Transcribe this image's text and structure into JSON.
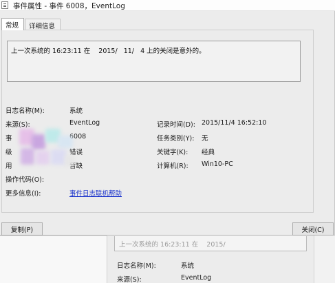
{
  "window": {
    "title": "事件属性 - 事件 6008，EventLog"
  },
  "tabs": [
    {
      "label": "常规",
      "active": true
    },
    {
      "label": "详细信息",
      "active": false
    }
  ],
  "description": "上一次系统的 16:23:11 在    2015/   11/   4 上的关闭是意外的。",
  "fields": {
    "log_name": {
      "label": "日志名称(M):",
      "value": "系统"
    },
    "source": {
      "label": "来源(S):",
      "value": "EventLog"
    },
    "event_id": {
      "label": "事",
      "value": "6008"
    },
    "level": {
      "label": "级",
      "value": "错误"
    },
    "user": {
      "label": "用",
      "value": "暂缺"
    },
    "op_code": {
      "label": "操作代码(O):",
      "value": ""
    },
    "more_info": {
      "label": "更多信息(I):",
      "value": "事件日志联机帮助"
    },
    "logged": {
      "label": "记录时间(D):",
      "value": "2015/11/4 16:52:10"
    },
    "task_category": {
      "label": "任务类别(Y):",
      "value": "无"
    },
    "keywords": {
      "label": "关键字(K):",
      "value": "经典"
    },
    "computer": {
      "label": "计算机(R):",
      "value": "Win10-PC"
    }
  },
  "buttons": {
    "copy": "复制(P)",
    "close": "关闭(C)"
  },
  "scroll": {
    "up_icon": "up-arrow",
    "down_icon": "down-arrow"
  },
  "background_window": {
    "description": "上一次系统的 16:23:11 在    2015/",
    "log_name_label": "日志名称(M):",
    "log_name_value": "系统",
    "source_label": "来源(S):",
    "source_value": "EventLog"
  },
  "colors": {
    "link": "#1a33cc",
    "panel": "#ececec"
  }
}
